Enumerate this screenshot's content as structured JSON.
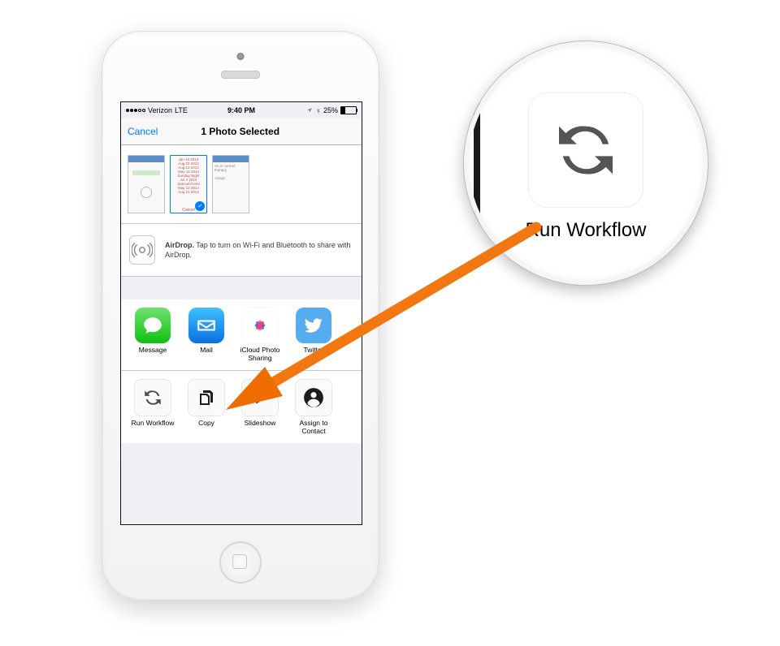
{
  "status_bar": {
    "carrier": "Verizon",
    "network": "LTE",
    "time": "9:40 PM",
    "battery_pct": "25%"
  },
  "nav": {
    "cancel": "Cancel",
    "title": "1 Photo Selected"
  },
  "airdrop": {
    "bold": "AirDrop.",
    "text": " Tap to turn on Wi-Fi and Bluetooth to share with AirDrop."
  },
  "share_apps": [
    {
      "label": "Message"
    },
    {
      "label": "Mail"
    },
    {
      "label": "iCloud Photo Sharing"
    },
    {
      "label": "Twitter"
    }
  ],
  "share_actions": [
    {
      "label": "Run Workflow"
    },
    {
      "label": "Copy"
    },
    {
      "label": "Slideshow"
    },
    {
      "label": "Assign to Contact"
    }
  ],
  "magnifier": {
    "label": "Run Workflow"
  }
}
